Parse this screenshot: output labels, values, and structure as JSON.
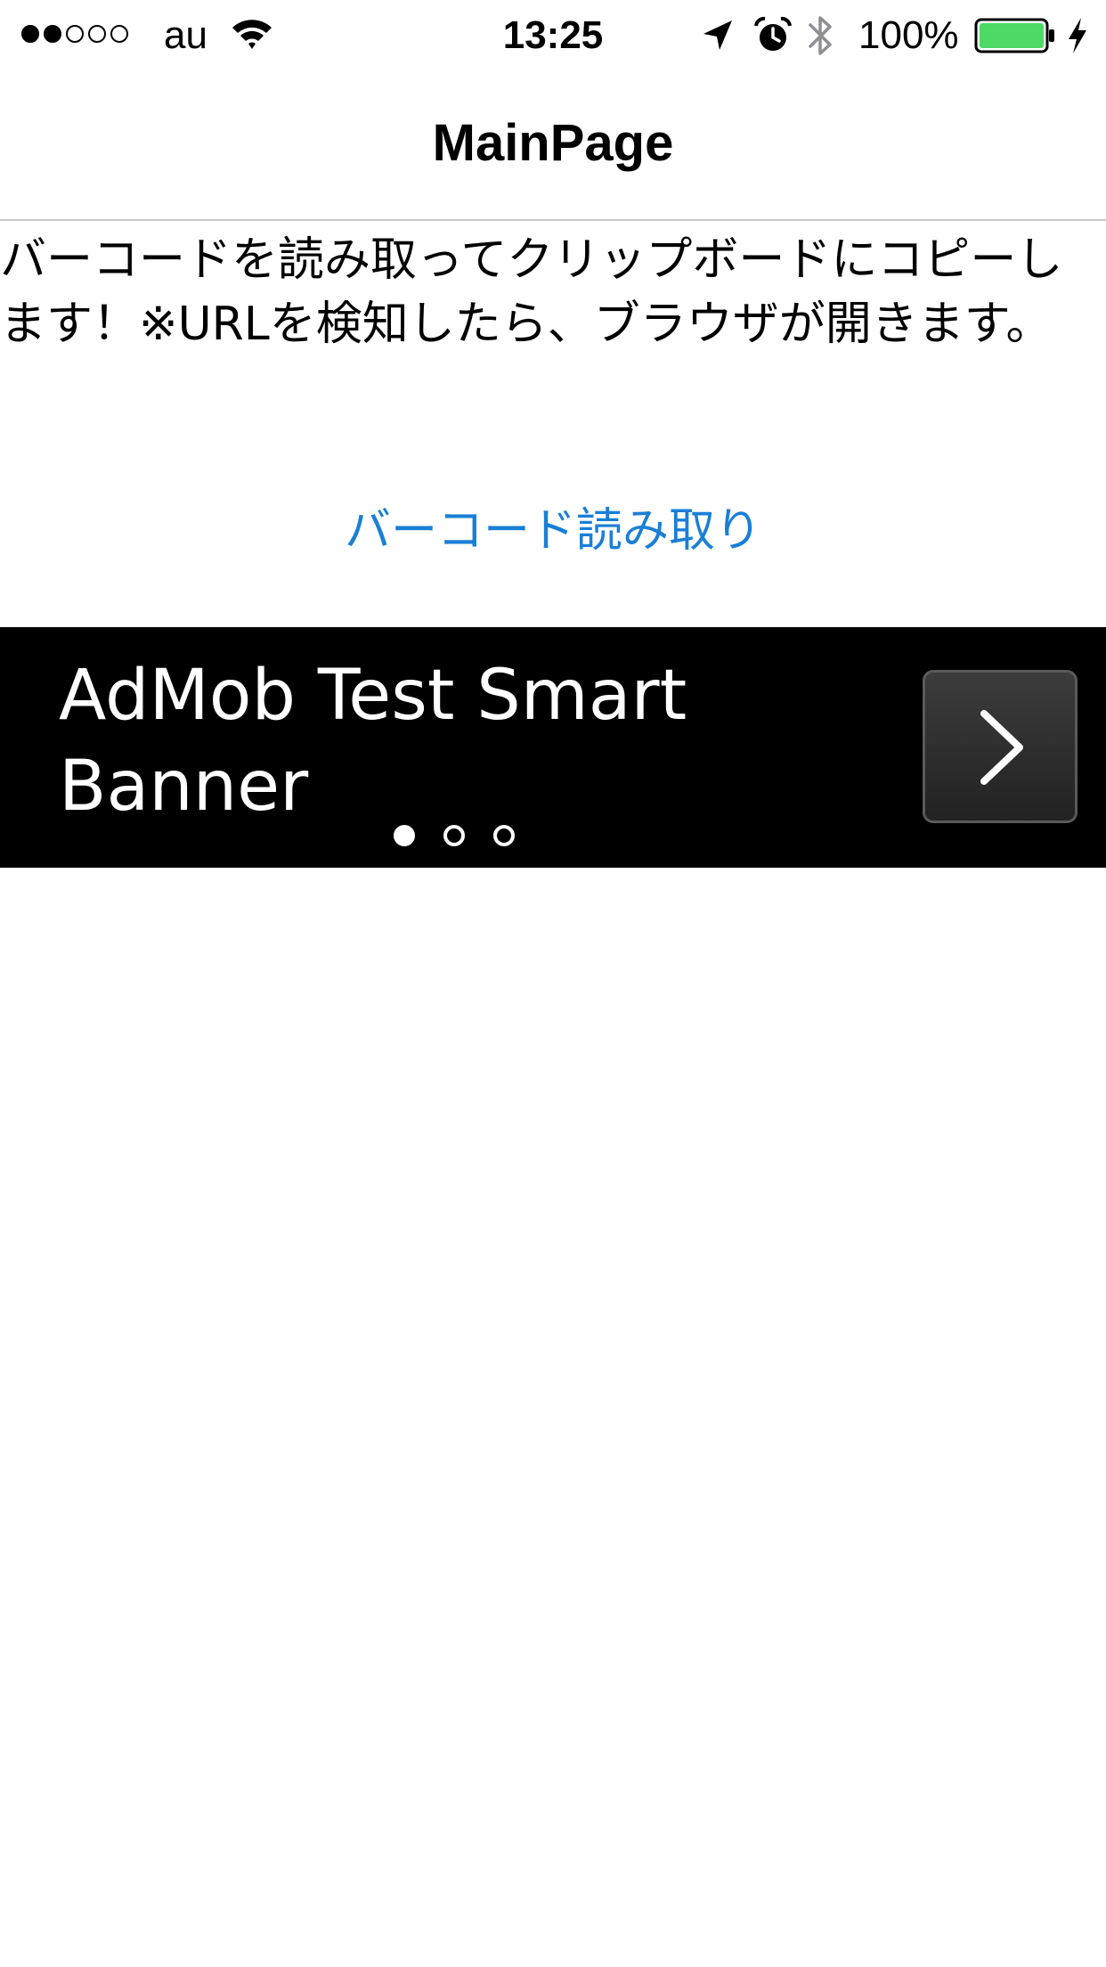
{
  "status_bar": {
    "signal_bars": [
      true,
      true,
      false,
      false,
      false
    ],
    "carrier": "au",
    "time": "13:25",
    "battery_percent": "100%",
    "battery_level": 1.0,
    "battery_color": "#4cd964",
    "icons": [
      "wifi-icon",
      "location-arrow-icon",
      "alarm-clock-icon",
      "bluetooth-icon",
      "battery-icon",
      "charging-bolt-icon"
    ]
  },
  "nav": {
    "title": "MainPage"
  },
  "main": {
    "description": "バーコードを読み取ってクリップボードにコピーします！※URLを検知したら、ブラウザが開きます。",
    "scan_button_label": "バーコード読み取り",
    "link_color": "#1a7fd6"
  },
  "ad_banner": {
    "text": "AdMob Test Smart Banner",
    "pager": {
      "count": 3,
      "active_index": 0
    },
    "arrow_icon": "chevron-right-icon"
  }
}
